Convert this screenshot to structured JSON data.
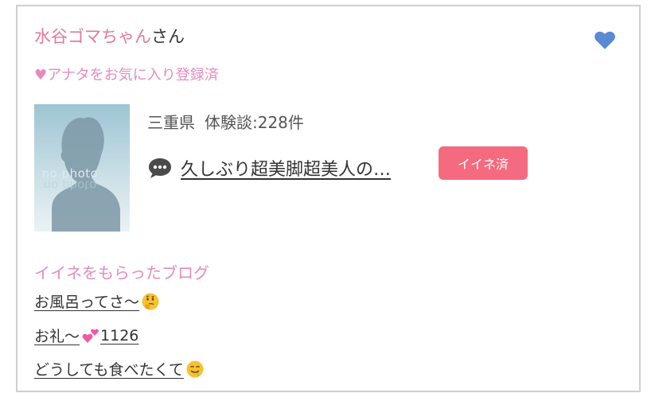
{
  "user": {
    "name": "水谷ゴマちゃん",
    "honorific": "さん",
    "favorite_status": "♥アナタをお気に入り登録済"
  },
  "avatar": {
    "placeholder_text": "no photo"
  },
  "profile": {
    "prefecture": "三重県",
    "review_count": "体験談:228件"
  },
  "latest_review": {
    "icon": "speech-bubble-icon",
    "title": "久しぶり超美脚超美人の…",
    "iine_badge": "イイネ済"
  },
  "blogs": {
    "heading": "イイネをもらったブログ",
    "items": [
      {
        "text": "お風呂ってさ〜",
        "emoji": "thinking-face-icon"
      },
      {
        "text": "お礼〜",
        "emoji": "two-hearts-icon",
        "suffix": " 1126"
      },
      {
        "text": "どうしても食べたくて",
        "emoji": "drooling-face-icon"
      }
    ]
  },
  "colors": {
    "name_pink": "#e07a9a",
    "label_pink": "#e58bbd",
    "badge": "#f46b7f",
    "heart_blue": "#5a8ad4"
  }
}
